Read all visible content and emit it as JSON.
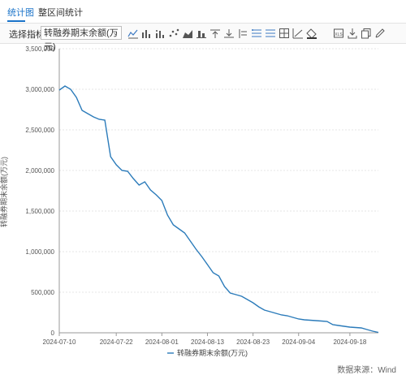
{
  "tabs": [
    {
      "label": "统计图",
      "active": true
    },
    {
      "label": "整区间统计",
      "active": false
    }
  ],
  "toolbar": {
    "indicator_label": "选择指标",
    "indicator_value": "转融券期末余额(万元)",
    "icons": [
      "line-chart-icon",
      "bar-chart-icon",
      "dot-bar-icon",
      "scatter-icon",
      "area-chart-icon",
      "column-chart-icon",
      "max-marker-icon",
      "min-marker-icon",
      "avg-line-icon",
      "gridlines-icon",
      "table-icon",
      "trend-icon",
      "fill-color-icon",
      "image-export-icon",
      "download-icon",
      "copy-icon",
      "edit-icon",
      "fullscreen-icon"
    ],
    "accent": "#1a73c9"
  },
  "source": "数据来源：Wind",
  "chart_data": {
    "type": "line",
    "title": "",
    "xlabel": "",
    "ylabel": "转融券期末余额(万元)",
    "ylim": [
      0,
      3500000
    ],
    "yticks": [
      0,
      500000,
      1000000,
      1500000,
      2000000,
      2500000,
      3000000,
      3500000
    ],
    "ytick_labels": [
      "0",
      "500,000",
      "1,000,000",
      "1,500,000",
      "2,000,000",
      "2,500,000",
      "3,000,000",
      "3,500,000"
    ],
    "x_tick_labels": [
      "2024-07-10",
      "2024-07-22",
      "2024-08-01",
      "2024-08-13",
      "2024-08-23",
      "2024-09-04",
      "2024-09-18"
    ],
    "x_tick_index": [
      0,
      10,
      18,
      26,
      34,
      42,
      51
    ],
    "grid": true,
    "legend": "bottom",
    "color": "#2b7bba",
    "series": [
      {
        "name": "转融券期末余额(万元)",
        "x": [
          "2024-07-10",
          "2024-07-11",
          "2024-07-12",
          "2024-07-15",
          "2024-07-16",
          "2024-07-17",
          "2024-07-18",
          "2024-07-19",
          "2024-07-22",
          "2024-07-23",
          "2024-07-24",
          "2024-07-25",
          "2024-07-26",
          "2024-07-29",
          "2024-07-30",
          "2024-07-31",
          "2024-08-01",
          "2024-08-02",
          "2024-08-05",
          "2024-08-06",
          "2024-08-07",
          "2024-08-08",
          "2024-08-09",
          "2024-08-12",
          "2024-08-13",
          "2024-08-14",
          "2024-08-15",
          "2024-08-16",
          "2024-08-19",
          "2024-08-20",
          "2024-08-21",
          "2024-08-22",
          "2024-08-23",
          "2024-08-26",
          "2024-08-27",
          "2024-08-28",
          "2024-08-29",
          "2024-08-30",
          "2024-09-02",
          "2024-09-03",
          "2024-09-04",
          "2024-09-05",
          "2024-09-06",
          "2024-09-09",
          "2024-09-10",
          "2024-09-11",
          "2024-09-12",
          "2024-09-13",
          "2024-09-18",
          "2024-09-19",
          "2024-09-20",
          "2024-09-23",
          "2024-09-24",
          "2024-09-25",
          "2024-09-26",
          "2024-09-27",
          "2024-09-30"
        ],
        "values": [
          2990000,
          3040000,
          3000000,
          2900000,
          2740000,
          2700000,
          2660000,
          2630000,
          2620000,
          2170000,
          2070000,
          2000000,
          1990000,
          1900000,
          1820000,
          1860000,
          1760000,
          1700000,
          1630000,
          1450000,
          1330000,
          1280000,
          1230000,
          1130000,
          1030000,
          940000,
          840000,
          740000,
          700000,
          570000,
          490000,
          470000,
          450000,
          410000,
          370000,
          320000,
          280000,
          260000,
          240000,
          220000,
          210000,
          190000,
          170000,
          160000,
          155000,
          150000,
          145000,
          140000,
          100000,
          90000,
          80000,
          70000,
          65000,
          60000,
          40000,
          20000,
          5000
        ]
      }
    ]
  }
}
